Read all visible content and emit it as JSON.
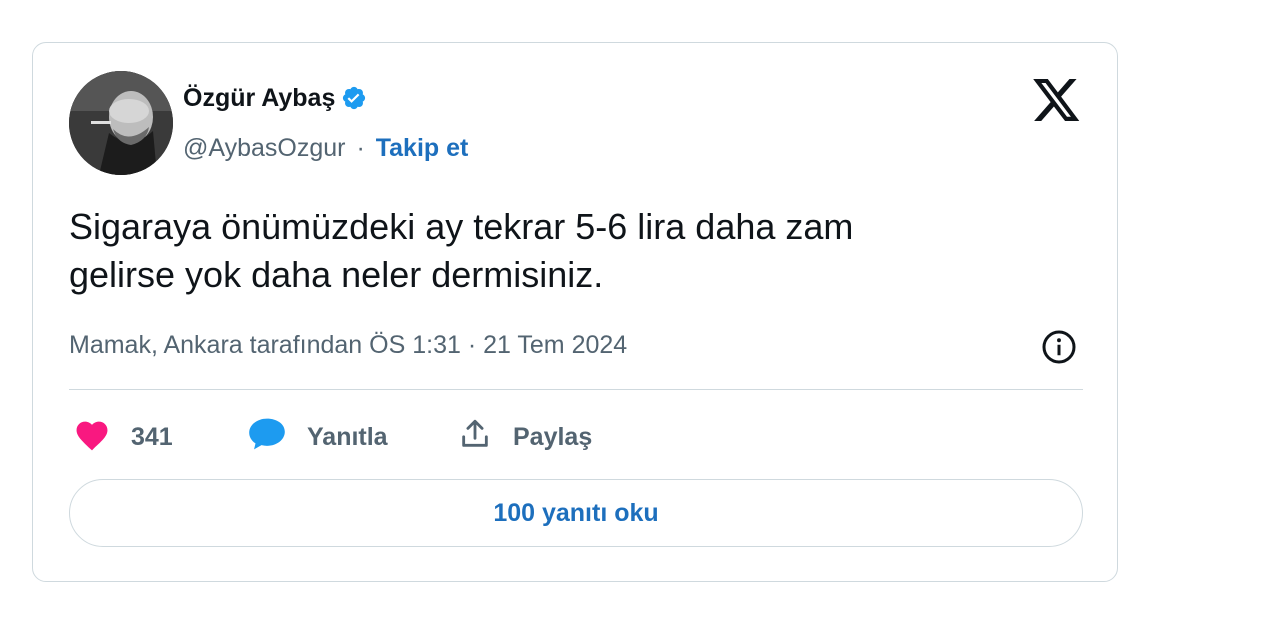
{
  "author": {
    "name": "Özgür Aybaş",
    "handle": "@AybasOzgur",
    "separator": "·",
    "follow_label": "Takip et"
  },
  "tweet": {
    "text_line1": "Sigaraya önümüzdeki ay tekrar 5-6 lira daha zam",
    "text_line2": "gelirse yok daha neler dermisiniz.",
    "meta": "Mamak, Ankara tarafından ÖS 1:31 · 21 Tem 2024"
  },
  "actions": {
    "like_count": "341",
    "reply_label": "Yanıtla",
    "share_label": "Paylaş"
  },
  "read_replies_label": "100 yanıtı oku",
  "icons": {
    "verified": "verified-badge-icon",
    "logo": "x-logo-icon",
    "info": "info-icon",
    "like": "heart-icon",
    "reply": "speech-bubble-icon",
    "share": "share-upload-icon"
  },
  "colors": {
    "heart": "#f91880",
    "reply_bubble": "#1d9bf0",
    "link": "#1d6fbd",
    "verified": "#1d9bf0",
    "secondary_text": "#536471",
    "border": "#cfd9de"
  }
}
